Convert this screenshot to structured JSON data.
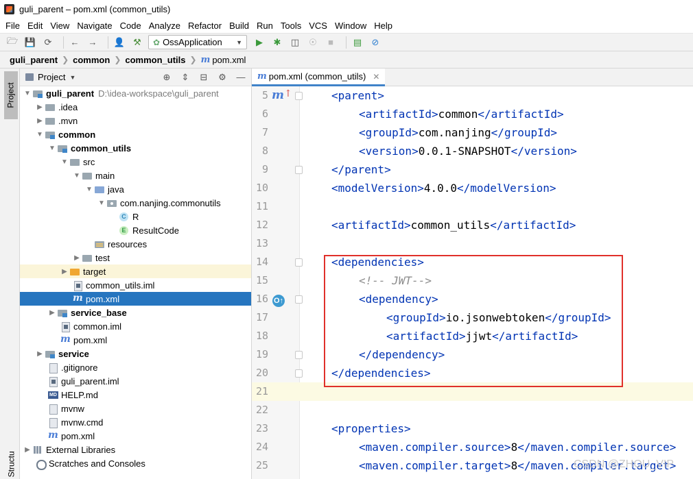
{
  "window": {
    "title": "guli_parent – pom.xml (common_utils)"
  },
  "menu": [
    "File",
    "Edit",
    "View",
    "Navigate",
    "Code",
    "Analyze",
    "Refactor",
    "Build",
    "Run",
    "Tools",
    "VCS",
    "Window",
    "Help"
  ],
  "toolbar": {
    "run_config": "OssApplication"
  },
  "breadcrumb": {
    "items": [
      "guli_parent",
      "common",
      "common_utils"
    ],
    "file": "pom.xml"
  },
  "stripe": {
    "project_label": "Project",
    "structure_label": "Structure"
  },
  "project_panel": {
    "title": "Project",
    "tree": [
      {
        "label": "guli_parent",
        "path": "D:\\idea-workspace\\guli_parent"
      },
      {
        "label": ".idea"
      },
      {
        "label": ".mvn"
      },
      {
        "label": "common"
      },
      {
        "label": "common_utils"
      },
      {
        "label": "src"
      },
      {
        "label": "main"
      },
      {
        "label": "java"
      },
      {
        "label": "com.nanjing.commonutils"
      },
      {
        "label": "R"
      },
      {
        "label": "ResultCode"
      },
      {
        "label": "resources"
      },
      {
        "label": "test"
      },
      {
        "label": "target"
      },
      {
        "label": "common_utils.iml"
      },
      {
        "label": "pom.xml"
      },
      {
        "label": "service_base"
      },
      {
        "label": "common.iml"
      },
      {
        "label": "pom.xml"
      },
      {
        "label": "service"
      },
      {
        "label": ".gitignore"
      },
      {
        "label": "guli_parent.iml"
      },
      {
        "label": "HELP.md"
      },
      {
        "label": "mvnw"
      },
      {
        "label": "mvnw.cmd"
      },
      {
        "label": "pom.xml"
      },
      {
        "label": "External Libraries"
      },
      {
        "label": "Scratches and Consoles"
      }
    ]
  },
  "editor": {
    "tab_label": "pom.xml (common_utils)",
    "lines": [
      {
        "num": "5",
        "tag1": "<parent>"
      },
      {
        "num": "6",
        "tag1": "<artifactId>",
        "text": "common",
        "tag2": "</artifactId>"
      },
      {
        "num": "7",
        "tag1": "<groupId>",
        "text": "com.nanjing",
        "tag2": "</groupId>"
      },
      {
        "num": "8",
        "tag1": "<version>",
        "text": "0.0.1-SNAPSHOT",
        "tag2": "</version>"
      },
      {
        "num": "9",
        "tag1": "</parent>"
      },
      {
        "num": "10",
        "tag1": "<modelVersion>",
        "text": "4.0.0",
        "tag2": "</modelVersion>"
      },
      {
        "num": "11"
      },
      {
        "num": "12",
        "tag1": "<artifactId>",
        "text": "common_utils",
        "tag2": "</artifactId>"
      },
      {
        "num": "13"
      },
      {
        "num": "14",
        "tag1": "<dependencies>"
      },
      {
        "num": "15",
        "comment": "<!-- JWT-->"
      },
      {
        "num": "16",
        "tag1": "<dependency>"
      },
      {
        "num": "17",
        "tag1": "<groupId>",
        "text": "io.jsonwebtoken",
        "tag2": "</groupId>"
      },
      {
        "num": "18",
        "tag1": "<artifactId>",
        "text": "jjwt",
        "tag2": "</artifactId>"
      },
      {
        "num": "19",
        "tag1": "</dependency>"
      },
      {
        "num": "20",
        "tag1": "</dependencies>"
      },
      {
        "num": "21"
      },
      {
        "num": "22"
      },
      {
        "num": "23",
        "tag1": "<properties>"
      },
      {
        "num": "24",
        "tag1": "<maven.compiler.source>",
        "text": "8",
        "tag2": "</maven.compiler.source>"
      },
      {
        "num": "25",
        "tag1": "<maven.compiler.target>",
        "text": "8",
        "tag2": "</maven.compiler.target>"
      }
    ]
  },
  "watermark": "CSDN @ZHOU_VIP",
  "colors": {
    "selection": "#2675bf",
    "annotation_box": "#e0302a",
    "tag": "#0033b3",
    "current_line": "#fcfae3"
  }
}
